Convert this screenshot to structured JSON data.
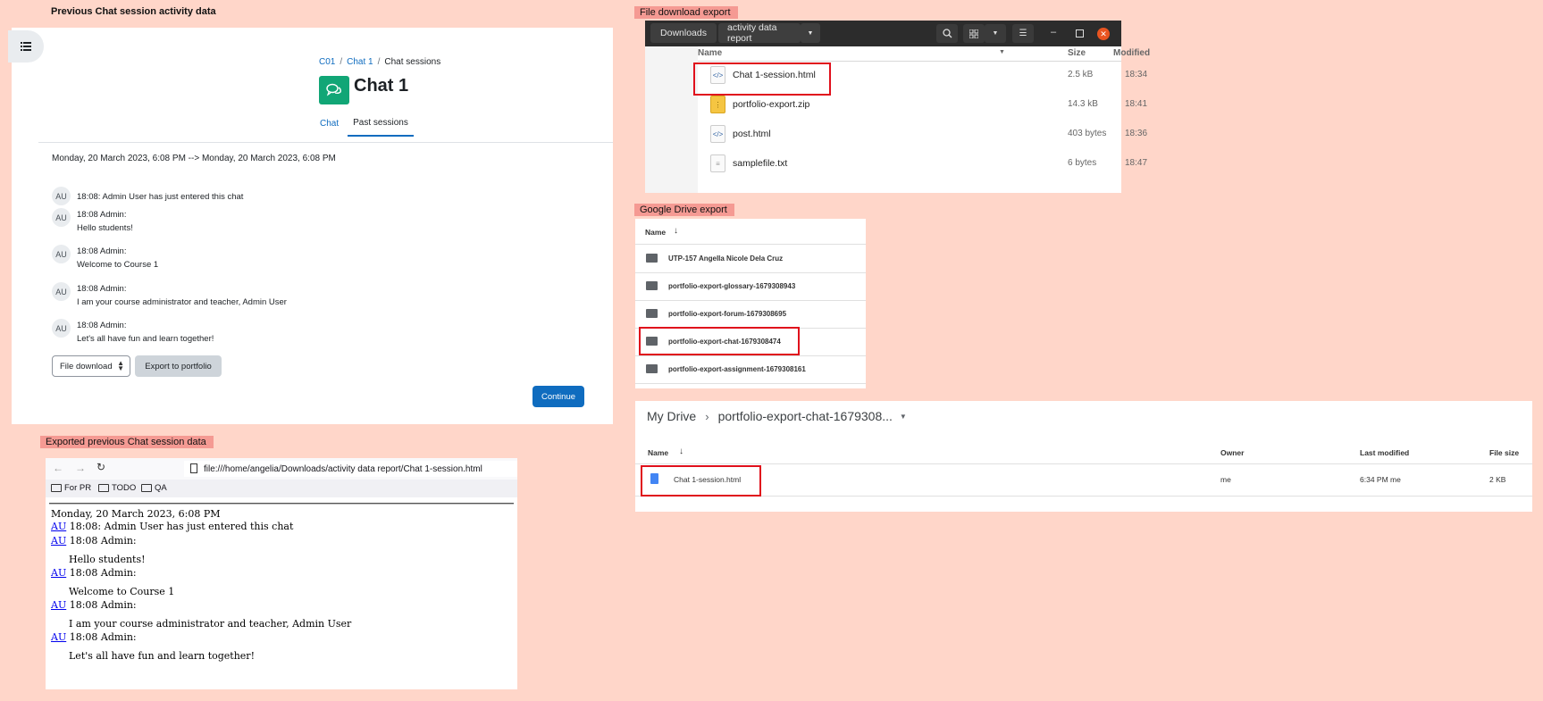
{
  "labels": {
    "previous_session": "Previous Chat session activity data",
    "exported_session": "Exported previous Chat session data",
    "file_download": "File download export",
    "google_drive": "Google Drive export"
  },
  "moodle": {
    "breadcrumb": [
      "C01",
      "Chat 1",
      "Chat sessions"
    ],
    "title": "Chat 1",
    "tabs": [
      "Chat",
      "Past sessions"
    ],
    "session_range": "Monday, 20 March 2023, 6:08 PM --> Monday, 20 March 2023, 6:08 PM",
    "messages": [
      {
        "avatar": "AU",
        "line1": "18:08: Admin User has just entered this chat",
        "line2": ""
      },
      {
        "avatar": "AU",
        "line1": "18:08 Admin:",
        "line2": "Hello students!"
      },
      {
        "avatar": "AU",
        "line1": "18:08 Admin:",
        "line2": "Welcome to Course 1"
      },
      {
        "avatar": "AU",
        "line1": "18:08 Admin:",
        "line2": "I am your course administrator and teacher, Admin User"
      },
      {
        "avatar": "AU",
        "line1": "18:08 Admin:",
        "line2": "Let's all have fun and learn together!"
      }
    ],
    "format_select": "File download",
    "export_button": "Export to portfolio",
    "continue_button": "Continue",
    "accent_color": "#0f6cbf",
    "chat_icon_color": "#11a676"
  },
  "browser": {
    "url": "file:///home/angelia/Downloads/activity data report/Chat 1-session.html",
    "bookmarks": [
      "For PR",
      "TODO",
      "QA"
    ],
    "date_line": "Monday, 20 March 2023, 6:08 PM",
    "entered_line": "18:08: Admin User has just entered this chat",
    "avatar_link": "AU",
    "admin_line": "18:08 Admin:",
    "messages": [
      "Hello students!",
      "Welcome to Course 1",
      "I am your course administrator and teacher, Admin User",
      "Let's all have fun and learn together!"
    ]
  },
  "file_manager": {
    "path_root": "Downloads",
    "path_current": "activity data report",
    "columns": [
      "Name",
      "Size",
      "Modified"
    ],
    "files": [
      {
        "name": "Chat 1-session.html",
        "size": "2.5 kB",
        "modified": "18:34",
        "icon": "html-file-icon"
      },
      {
        "name": "portfolio-export.zip",
        "size": "14.3 kB",
        "modified": "18:41",
        "icon": "zip-file-icon"
      },
      {
        "name": "post.html",
        "size": "403 bytes",
        "modified": "18:36",
        "icon": "html-file-icon"
      },
      {
        "name": "samplefile.txt",
        "size": "6 bytes",
        "modified": "18:47",
        "icon": "text-file-icon"
      }
    ],
    "close_color": "#e95420"
  },
  "gdrive_list": {
    "column": "Name",
    "items": [
      "UTP-157 Angella Nicole Dela Cruz",
      "portfolio-export-glossary-1679308943",
      "portfolio-export-forum-1679308695",
      "portfolio-export-chat-1679308474",
      "portfolio-export-assignment-1679308161"
    ]
  },
  "gdrive_folder": {
    "root": "My Drive",
    "folder": "portfolio-export-chat-1679308...",
    "columns": [
      "Name",
      "Owner",
      "Last modified",
      "File size"
    ],
    "file": {
      "name": "Chat 1-session.html",
      "owner": "me",
      "modified": "6:34 PM",
      "modified_by": "me",
      "size": "2 KB"
    }
  },
  "highlight_color": "#e0101c"
}
